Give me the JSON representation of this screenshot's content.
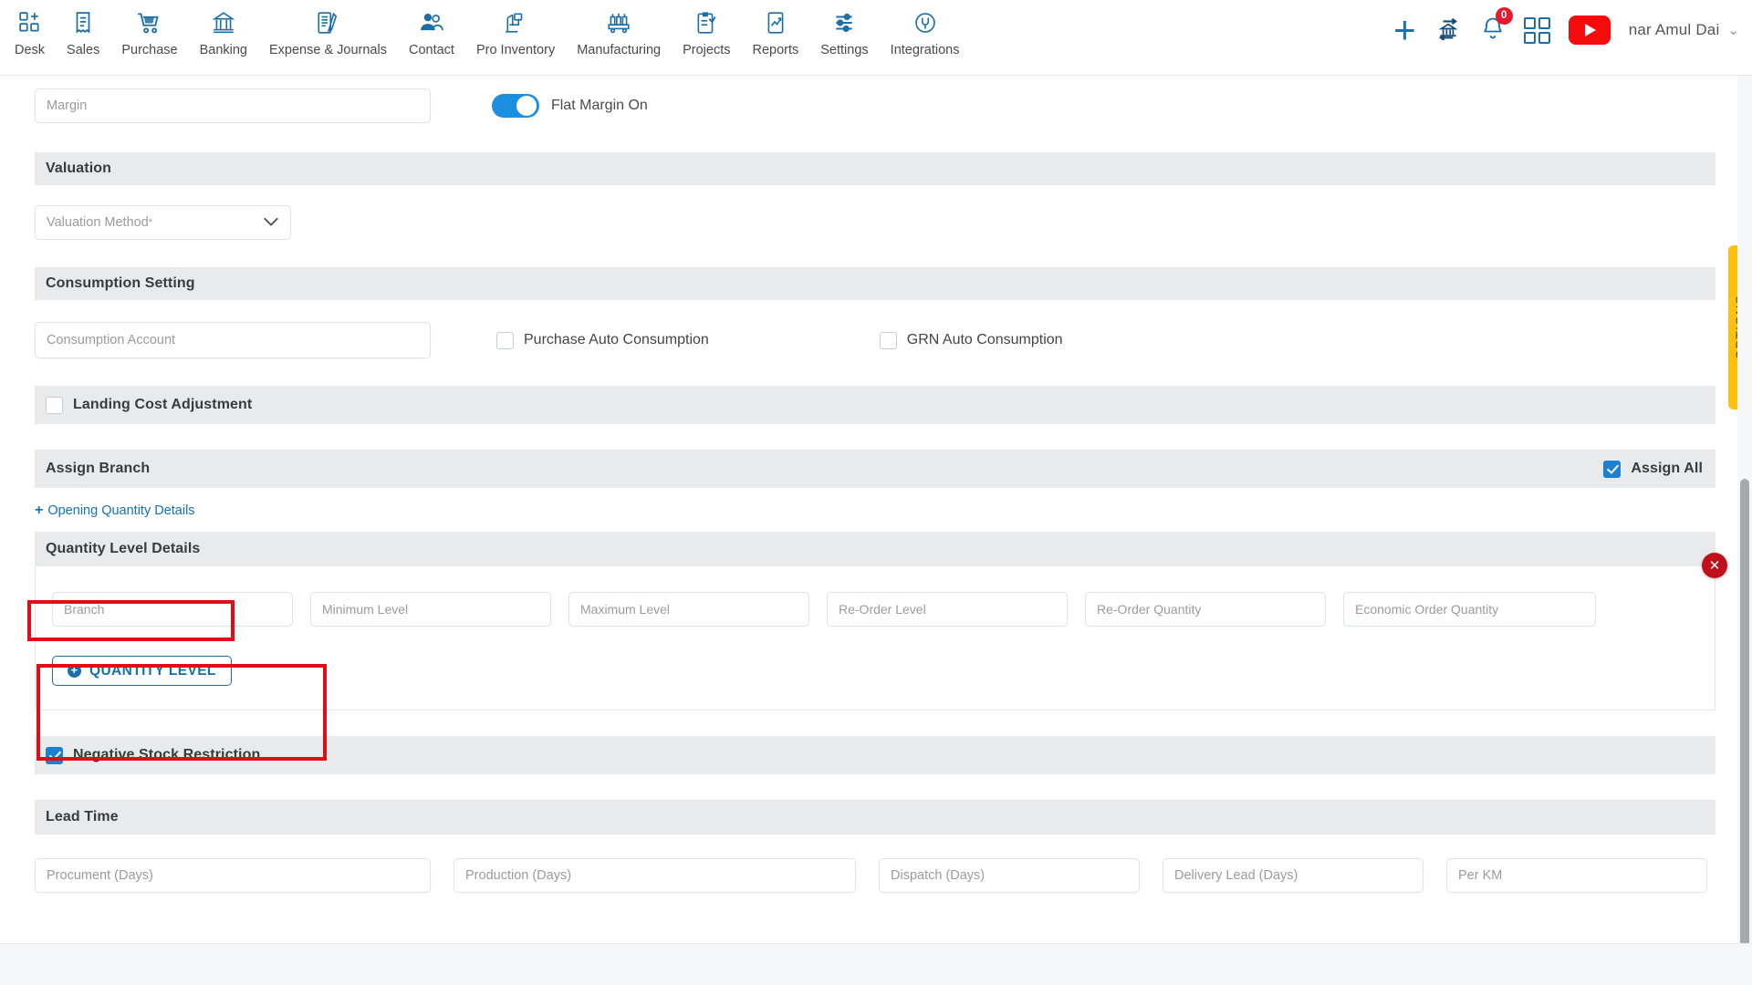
{
  "topnav": {
    "items": [
      {
        "label": "Desk",
        "icon": "desk-icon"
      },
      {
        "label": "Sales",
        "icon": "sales-receipt-icon"
      },
      {
        "label": "Purchase",
        "icon": "cart-icon"
      },
      {
        "label": "Banking",
        "icon": "bank-icon"
      },
      {
        "label": "Expense & Journals",
        "icon": "journal-pen-icon"
      },
      {
        "label": "Contact",
        "icon": "people-icon"
      },
      {
        "label": "Pro Inventory",
        "icon": "inventory-icon"
      },
      {
        "label": "Manufacturing",
        "icon": "factory-cart-icon"
      },
      {
        "label": "Projects",
        "icon": "clipboard-icon"
      },
      {
        "label": "Reports",
        "icon": "report-chart-icon"
      },
      {
        "label": "Settings",
        "icon": "sliders-icon"
      },
      {
        "label": "Integrations",
        "icon": "plug-icon"
      }
    ],
    "add_label": "+",
    "notification_count": "0",
    "user_name": "nar Amul Dai",
    "user_caret": "⌄"
  },
  "margin": {
    "placeholder": "Margin",
    "toggle_label": "Flat Margin On",
    "toggle_on": true
  },
  "valuation": {
    "title": "Valuation",
    "method_placeholder": "Valuation Method",
    "required_mark": "*",
    "caret": "⌄"
  },
  "consumption": {
    "title": "Consumption Setting",
    "account_placeholder": "Consumption Account",
    "purchase_auto_label": "Purchase Auto Consumption",
    "grn_auto_label": "GRN Auto Consumption"
  },
  "landing_cost": {
    "label": "Landing Cost Adjustment"
  },
  "assign_branch": {
    "title": "Assign Branch",
    "assign_all_label": "Assign All"
  },
  "opening_quantity": {
    "link_label": "Opening Quantity Details",
    "plus": "+"
  },
  "quantity_level": {
    "title": "Quantity Level Details",
    "fields": [
      {
        "placeholder": "Branch"
      },
      {
        "placeholder": "Minimum Level"
      },
      {
        "placeholder": "Maximum Level"
      },
      {
        "placeholder": "Re-Order Level"
      },
      {
        "placeholder": "Re-Order Quantity"
      },
      {
        "placeholder": "Economic Order Quantity"
      }
    ],
    "delete_icon": "✕",
    "add_button_label": "QUANTITY LEVEL",
    "add_button_icon": "+"
  },
  "negative_stock": {
    "label": "Negative Stock Restriction",
    "checked": true
  },
  "lead_time": {
    "title": "Lead Time",
    "fields": [
      {
        "placeholder": "Procument (Days)"
      },
      {
        "placeholder": "Production (Days)"
      },
      {
        "placeholder": "Dispatch (Days)"
      },
      {
        "placeholder": "Delivery Lead (Days)"
      },
      {
        "placeholder": "Per KM"
      }
    ]
  },
  "options_tab": {
    "label": "OPTIONS"
  },
  "colors": {
    "accent_blue": "#1b6fa8",
    "toggle_blue": "#1d8fe0",
    "checkbox_blue": "#1b7fd4",
    "danger_red": "#c10f1c",
    "annotation_red": "#e00d17",
    "options_yellow": "#fcc010",
    "youtube_red": "#f40c0c",
    "section_grey": "#e9eaec"
  }
}
